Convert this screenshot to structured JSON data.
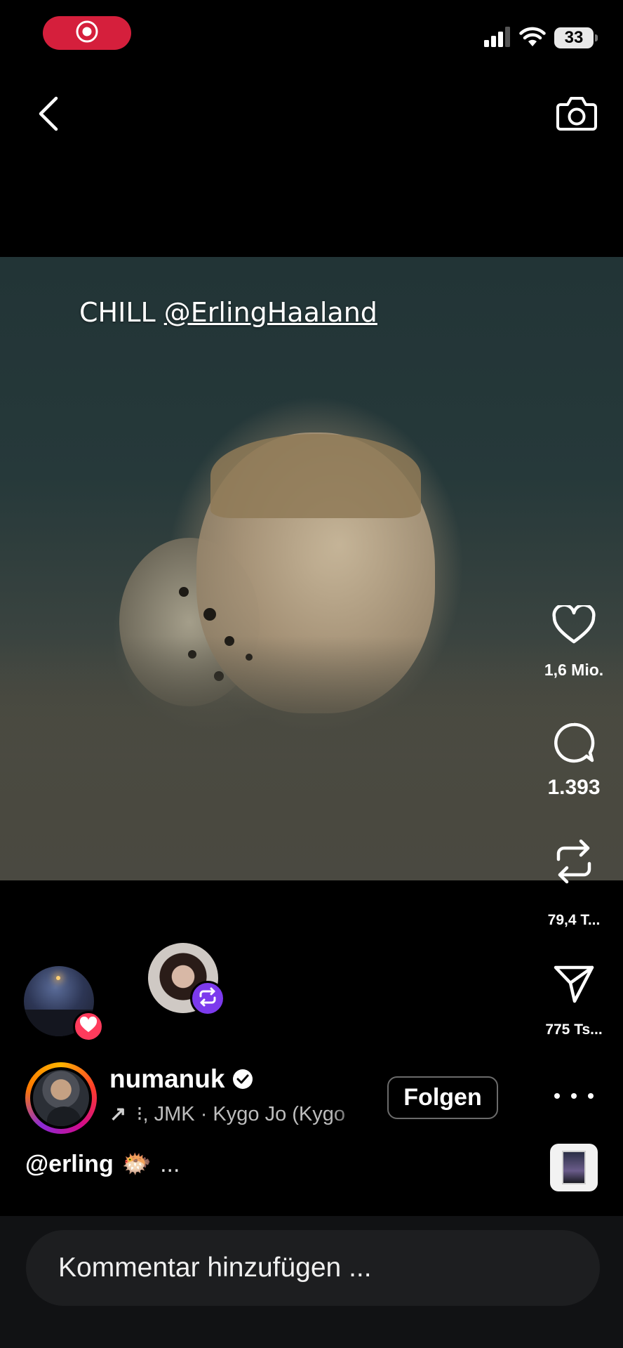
{
  "status_bar": {
    "battery": "33",
    "icons": [
      "record-icon",
      "signal-icon",
      "wifi-icon",
      "battery-icon"
    ]
  },
  "top_bar": {
    "icons": [
      "back-chevron-icon",
      "camera-icon"
    ]
  },
  "video": {
    "caption_prefix": "CHILL ",
    "caption_mention": "@ErlingHaaland"
  },
  "actions": {
    "like_count": "1,6 Mio.",
    "comment_count": "1.393",
    "repost_count": "79,4 T...",
    "share_count": "775 Ts..."
  },
  "post": {
    "username": "numanuk",
    "music_arrow": "↗",
    "music_text": "⁝, JMK · Kygo Jo (Kygo",
    "follow_label": "Folgen",
    "description": "@erling",
    "description_emoji": "🐡",
    "description_more": "..."
  },
  "comment": {
    "placeholder": "Kommentar hinzufügen ..."
  },
  "colors": {
    "record_pill": "#d51f3c",
    "repost_badge": "#7c3aed",
    "heart_badge": "#ff3b5c",
    "comment_bar": "#111214",
    "comment_input": "#1d1e20"
  }
}
